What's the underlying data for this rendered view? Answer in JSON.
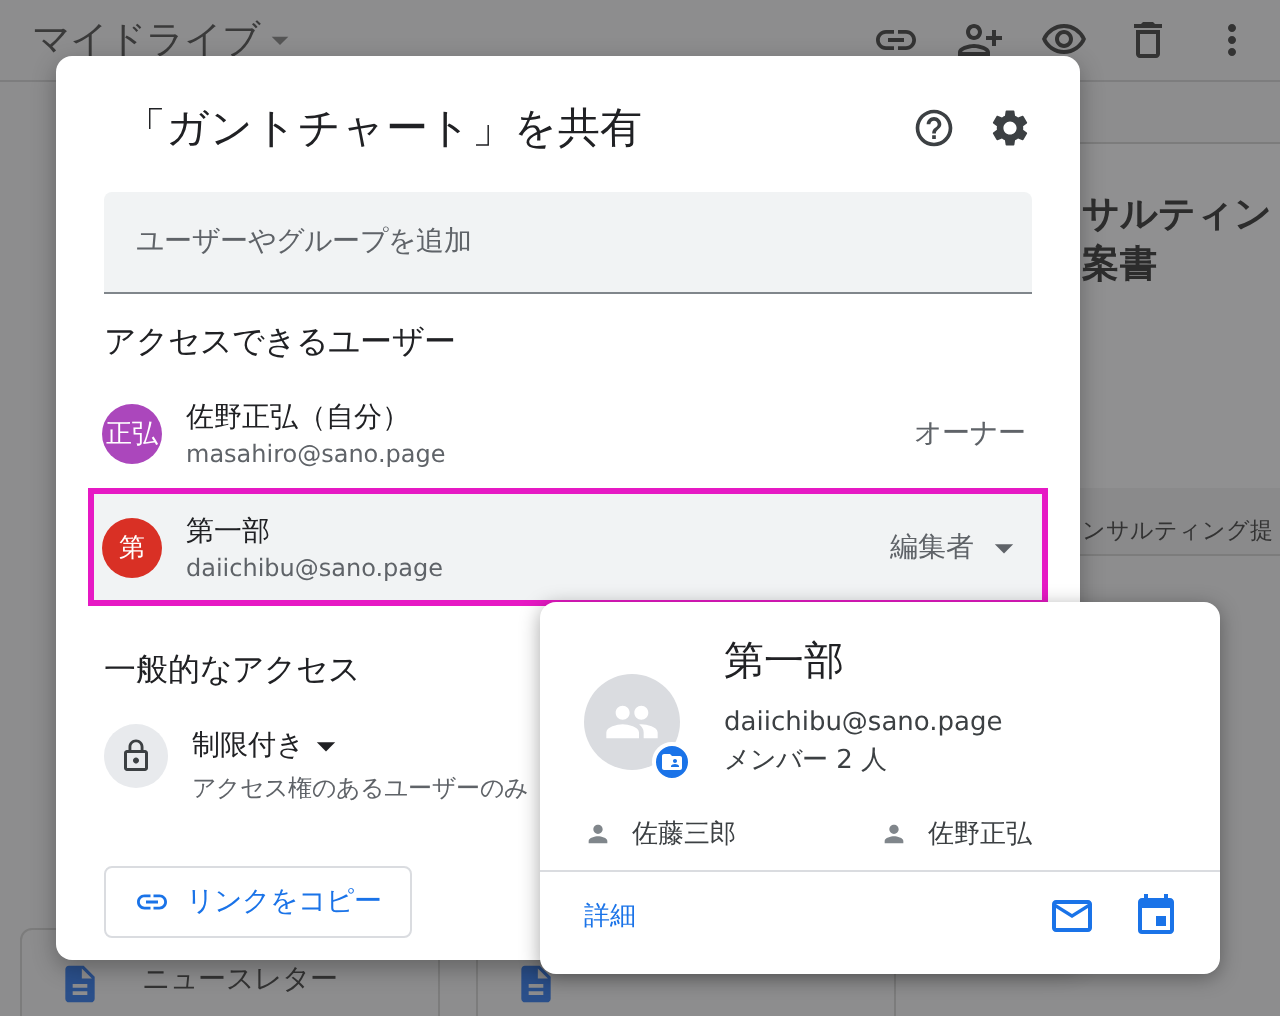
{
  "drive": {
    "title": "マイドライブ"
  },
  "background_files": [
    {
      "kind": "slides",
      "name": "ンサルティング提",
      "preview": [
        "サルティン",
        "案書"
      ]
    },
    {
      "kind": "doc",
      "name": "ニュースレター"
    }
  ],
  "share_dialog": {
    "title": "「ガントチャート」を共有",
    "add_placeholder": "ユーザーやグループを追加",
    "people_heading": "アクセスできるユーザー",
    "people": [
      {
        "initials": "正弘",
        "color": "#ab47bc",
        "name": "佐野正弘（自分）",
        "email": "masahiro@sano.page",
        "role": "オーナー",
        "has_dropdown": false,
        "selected": false
      },
      {
        "initials": "第",
        "color": "#d93025",
        "name": "第一部",
        "email": "daiichibu@sano.page",
        "role": "編集者",
        "has_dropdown": true,
        "selected": true
      }
    ],
    "general_heading": "一般的なアクセス",
    "access_level": "制限付き",
    "access_description": "アクセス権のあるユーザーのみ",
    "copy_link": "リンクをコピー"
  },
  "group_card": {
    "name": "第一部",
    "email": "daiichibu@sano.page",
    "member_count": "メンバー 2 人",
    "members": [
      "佐藤三郎",
      "佐野正弘"
    ],
    "details": "詳細"
  }
}
